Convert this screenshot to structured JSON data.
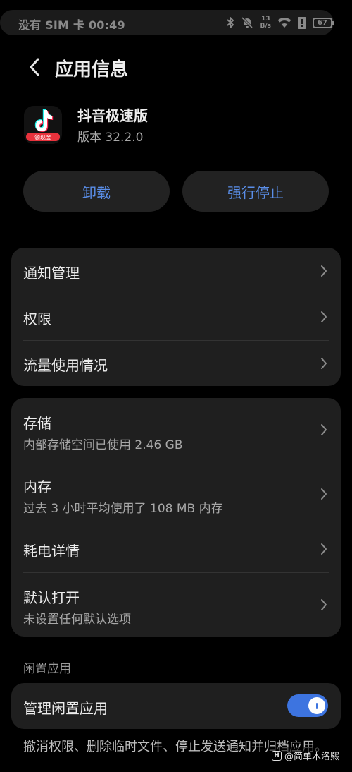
{
  "status_bar": {
    "carrier_time": "没有 SIM 卡 00:49",
    "speed_value": "13",
    "speed_unit": "B/s",
    "battery": "67"
  },
  "header": {
    "title": "应用信息"
  },
  "app": {
    "name": "抖音极速版",
    "version": "版本 32.2.0",
    "icon_badge": "领现金"
  },
  "actions": {
    "uninstall": "卸载",
    "force_stop": "强行停止"
  },
  "group1": [
    {
      "title": "通知管理"
    },
    {
      "title": "权限"
    },
    {
      "title": "流量使用情况"
    }
  ],
  "group2": [
    {
      "title": "存储",
      "subtitle": "内部存储空间已使用 2.46 GB"
    },
    {
      "title": "内存",
      "subtitle": "过去 3 小时平均使用了 108 MB 内存"
    },
    {
      "title": "耗电详情"
    },
    {
      "title": "默认打开",
      "subtitle": "未设置任何默认选项"
    }
  ],
  "idle": {
    "section_label": "闲置应用",
    "toggle_label": "管理闲置应用",
    "toggle_on": true,
    "description": "撤消权限、删除临时文件、停止发送通知并归档应用。"
  },
  "watermark": {
    "text": "@简单木洛熙"
  },
  "colors": {
    "accent": "#5a8ee8",
    "toggle": "#3d74e0",
    "card_bg": "#1f1f1f",
    "background": "#000000"
  }
}
